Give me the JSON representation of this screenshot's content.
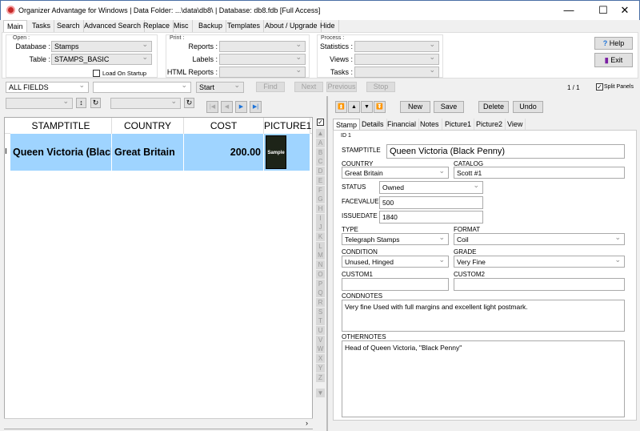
{
  "window": {
    "title": "Organizer Advantage for Windows | Data Folder: ...\\data\\db8\\ | Database: db8.fdb [Full Access]",
    "minimize": "—",
    "maximize": "☐",
    "close": "✕"
  },
  "menu_tabs": [
    "Main",
    "Tasks",
    "Search",
    "Advanced Search",
    "Replace",
    "Misc",
    "Backup",
    "Templates",
    "About / Upgrade",
    "Hide"
  ],
  "open": {
    "group": "Open :",
    "database_label": "Database :",
    "database_value": "Stamps",
    "table_label": "Table :",
    "table_value": "STAMPS_BASIC",
    "load_on_startup": "Load On Startup"
  },
  "print": {
    "group": "Print :",
    "reports": "Reports :",
    "labels": "Labels :",
    "html_reports": "HTML Reports :"
  },
  "process": {
    "group": "Process :",
    "statistics": "Statistics :",
    "views": "Views :",
    "tasks": "Tasks :"
  },
  "help": "Help",
  "exit": "Exit",
  "search": {
    "field": "ALL FIELDS",
    "value": "",
    "mode": "Start",
    "find": "Find",
    "next": "Next",
    "previous": "Previous",
    "stop": "Stop",
    "record_count": "1 / 1",
    "split_panels": "Split Panels"
  },
  "grid": {
    "columns": [
      "STAMPTITLE",
      "COUNTRY",
      "COST",
      "PICTURE1"
    ],
    "rows": [
      {
        "stamptitle": "Queen Victoria (Black Penny)",
        "country": "Great Britain",
        "cost": "200.00",
        "picture_text": "Sample"
      }
    ]
  },
  "alphabet": [
    "A",
    "B",
    "C",
    "D",
    "E",
    "F",
    "G",
    "H",
    "I",
    "J",
    "K",
    "L",
    "M",
    "N",
    "O",
    "P",
    "Q",
    "R",
    "S",
    "T",
    "U",
    "V",
    "W",
    "X",
    "Y",
    "Z"
  ],
  "record_buttons": {
    "new": "New",
    "save": "Save",
    "delete": "Delete",
    "undo": "Undo"
  },
  "form_tabs": [
    "Stamp",
    "Details",
    "Financial",
    "Notes",
    "Picture1",
    "Picture2",
    "View"
  ],
  "form": {
    "id": "ID 1",
    "stamptitle_label": "STAMPTITLE",
    "stamptitle": "Queen Victoria (Black Penny)",
    "country_label": "COUNTRY",
    "country": "Great Britain",
    "catalog_label": "CATALOG",
    "catalog": "Scott #1",
    "status_label": "STATUS",
    "status": "Owned",
    "facevalue_label": "FACEVALUE",
    "facevalue": "500",
    "issuedate_label": "ISSUEDATE",
    "issuedate": "1840",
    "type_label": "TYPE",
    "type": "Telegraph Stamps",
    "format_label": "FORMAT",
    "format": "Coil",
    "condition_label": "CONDITION",
    "condition": "Unused, Hinged",
    "grade_label": "GRADE",
    "grade": "Very Fine",
    "custom1_label": "CUSTOM1",
    "custom1": "",
    "custom2_label": "CUSTOM2",
    "custom2": "",
    "condnotes_label": "CONDNOTES",
    "condnotes": "Very fine Used with full margins and excellent  light  postmark.",
    "othernotes_label": "OTHERNOTES",
    "othernotes": "Head of Queen Victoria, \"Black Penny\""
  },
  "colors": {
    "selected_row": "#9fd4ff",
    "accent": "#1e73d8"
  }
}
